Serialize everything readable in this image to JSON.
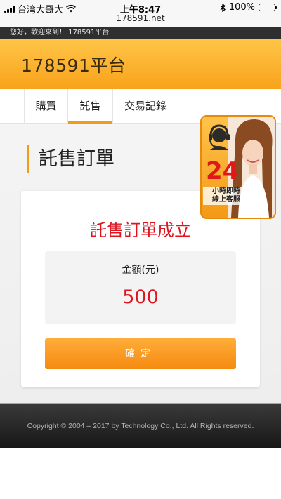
{
  "status_bar": {
    "carrier": "台湾大哥大",
    "time": "上午8:47",
    "battery": "100%",
    "url": "178591.net"
  },
  "welcome_text": "您好，歡迎來到！ 178591平台",
  "header": {
    "brand": "178591平台"
  },
  "nav": {
    "items": [
      {
        "label": "購買"
      },
      {
        "label": "託售"
      },
      {
        "label": "交易記錄"
      }
    ],
    "active_index": 1
  },
  "page": {
    "title": "託售訂單",
    "success_message": "託售訂單成立",
    "amount_label": "金額(元)",
    "amount_value": "500",
    "confirm_label": "確定"
  },
  "customer_service": {
    "number": "24",
    "text_line1": "小時即時",
    "text_line2": "線上客服"
  },
  "footer": {
    "copyright": "Copyright © 2004 – 2017 by Technology Co., Ltd. All Rights reserved."
  },
  "colors": {
    "accent": "#f29b1a",
    "header_top": "#ffc548",
    "header_bottom": "#f8a21a",
    "alert_red": "#e0141e",
    "footer_bg": "#1e1e1e"
  }
}
